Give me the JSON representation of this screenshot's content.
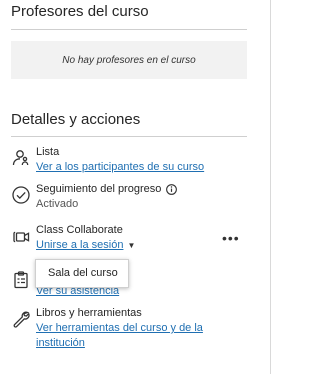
{
  "instructors": {
    "title": "Profesores del curso",
    "empty_text": "No hay profesores en el curso"
  },
  "details": {
    "title": "Detalles y acciones",
    "items": [
      {
        "icon": "roster-icon",
        "title": "Lista",
        "link": "Ver a los participantes de su curso"
      },
      {
        "icon": "progress-check-icon",
        "title": "Seguimiento del progreso",
        "info_icon": "info-icon",
        "status": "Activado"
      },
      {
        "icon": "video-camera-icon",
        "title": "Class Collaborate",
        "link": "Unirse a la sesión",
        "caret_icon": "caret-down-icon",
        "more_icon": "more-options-icon"
      },
      {
        "icon": "attendance-clipboard-icon",
        "link": "Ver su asistencia"
      },
      {
        "icon": "wrench-icon",
        "title": "Libros y herramientas",
        "link_line1": "Ver herramientas del curso y de la",
        "link_line2": "institución"
      }
    ],
    "dropdown": {
      "options": [
        "Sala del curso"
      ]
    }
  },
  "colors": {
    "link": "#1f6fb2",
    "text": "#262626",
    "empty_box_bg": "#f2f2f2",
    "rule": "#cfcfcf"
  }
}
